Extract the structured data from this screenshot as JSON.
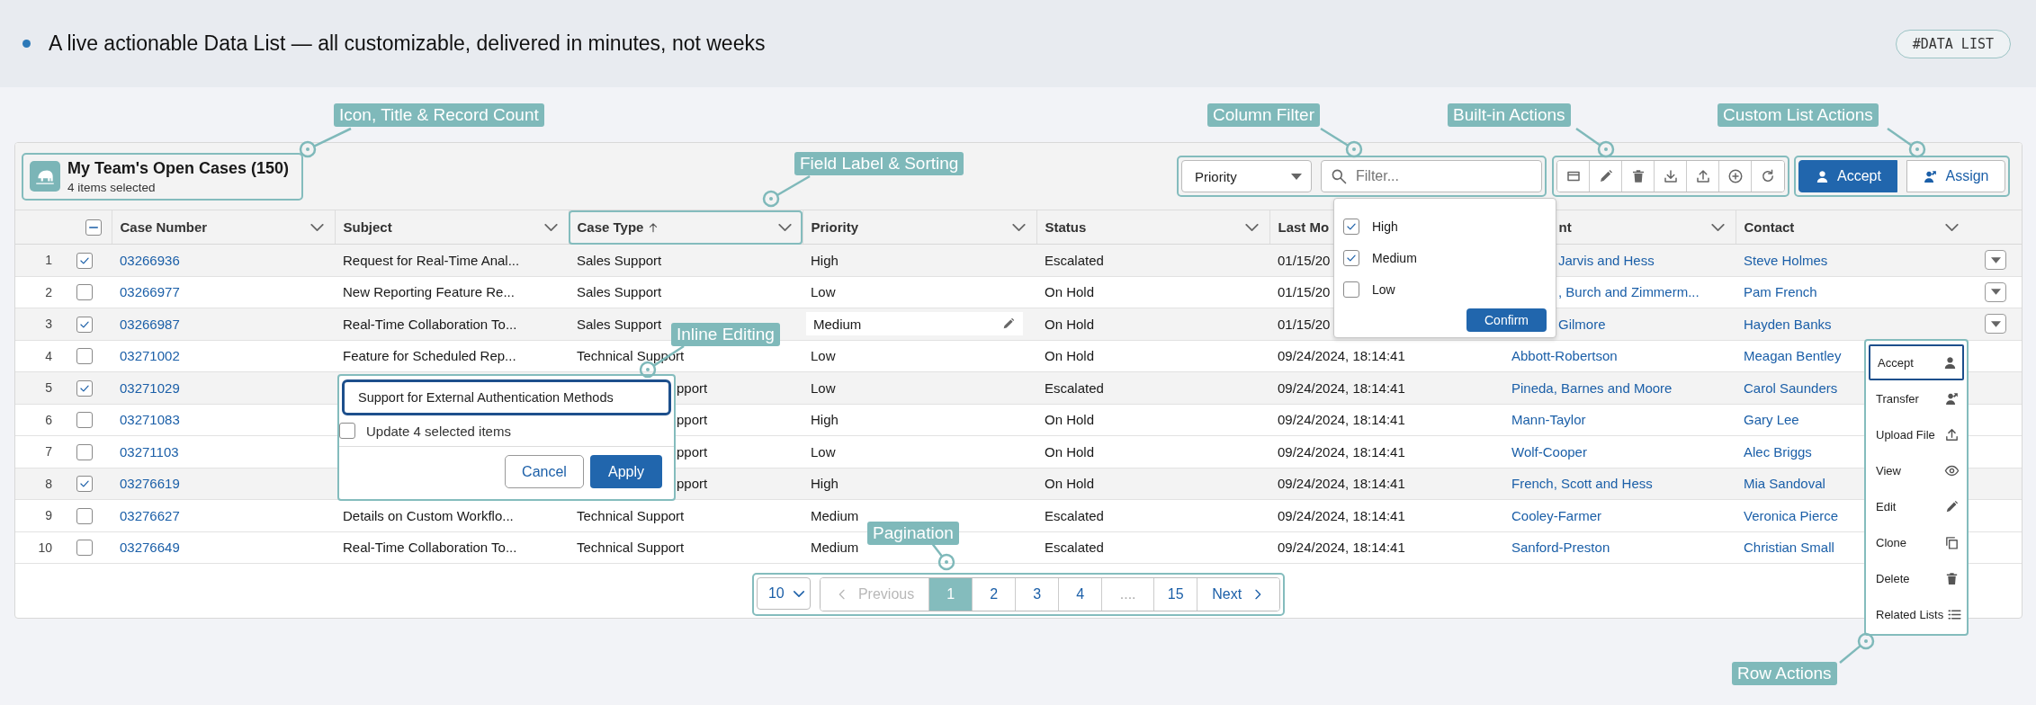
{
  "banner": {
    "text": "A live actionable Data List — all customizable, delivered in minutes, not weeks",
    "tag": "#DATA LIST"
  },
  "list": {
    "title": "My Team's Open Cases (150)",
    "subtitle": "4 items selected"
  },
  "filter": {
    "field": "Priority",
    "placeholder": "Filter...",
    "open": true,
    "confirm": "Confirm",
    "options": [
      {
        "label": "High",
        "checked": true
      },
      {
        "label": "Medium",
        "checked": true
      },
      {
        "label": "Low",
        "checked": false
      }
    ]
  },
  "built_in_actions": [
    {
      "kind": "card"
    },
    {
      "kind": "edit"
    },
    {
      "kind": "delete"
    },
    {
      "kind": "download"
    },
    {
      "kind": "upload"
    },
    {
      "kind": "add"
    },
    {
      "kind": "refresh"
    }
  ],
  "custom_actions": [
    {
      "label": "Accept",
      "kind": "accept",
      "primary": true
    },
    {
      "label": "Assign",
      "kind": "assign",
      "primary": false
    }
  ],
  "table": {
    "select_all": {
      "indeterminate": true
    },
    "columns": [
      {
        "label": "Case Number",
        "kind": "link",
        "sorted": false
      },
      {
        "label": "Subject",
        "kind": "text",
        "sorted": false
      },
      {
        "label": "Case Type",
        "kind": "text",
        "sorted": true
      },
      {
        "label": "Priority",
        "kind": "text",
        "sorted": false
      },
      {
        "label": "Status",
        "kind": "text",
        "sorted": false
      },
      {
        "label": "Last Mo",
        "kind": "text",
        "sorted": false
      },
      {
        "label": "nt",
        "kind": "link",
        "sorted": false
      },
      {
        "label": "Contact",
        "kind": "link",
        "sorted": false
      }
    ],
    "rows": [
      {
        "number": "1",
        "checked": true,
        "editing": false,
        "cells": [
          "03266936",
          "Request for Real-Time Anal...",
          "Sales Support",
          "High",
          "Escalated",
          "01/15/20",
          "Jarvis and Hess",
          "Steve Holmes"
        ]
      },
      {
        "number": "2",
        "checked": false,
        "editing": false,
        "cells": [
          "03266977",
          "New Reporting Feature Re...",
          "Sales Support",
          "Low",
          "On Hold",
          "01/15/20",
          ", Burch and Zimmerm...",
          "Pam French"
        ]
      },
      {
        "number": "3",
        "checked": true,
        "editing": true,
        "cells": [
          "03266987",
          "Real-Time Collaboration To...",
          "Sales Support",
          "Medium",
          "On Hold",
          "01/15/20",
          "Gilmore",
          "Hayden Banks"
        ]
      },
      {
        "number": "4",
        "checked": false,
        "editing": false,
        "cells": [
          "03271002",
          "Feature for Scheduled Rep...",
          "Technical Support",
          "Low",
          "On Hold",
          "09/24/2024, 18:14:41",
          "Abbott-Robertson",
          "Meagan Bentley"
        ]
      },
      {
        "number": "5",
        "checked": true,
        "editing": false,
        "cells": [
          "03271029",
          null,
          "pport",
          "Low",
          "Escalated",
          "09/24/2024, 18:14:41",
          "Pineda, Barnes and Moore",
          "Carol Saunders"
        ]
      },
      {
        "number": "6",
        "checked": false,
        "editing": false,
        "cells": [
          "03271083",
          null,
          "pport",
          "High",
          "On Hold",
          "09/24/2024, 18:14:41",
          "Mann-Taylor",
          "Gary Lee"
        ]
      },
      {
        "number": "7",
        "checked": false,
        "editing": false,
        "cells": [
          "03271103",
          null,
          "pport",
          "Low",
          "On Hold",
          "09/24/2024, 18:14:41",
          "Wolf-Cooper",
          "Alec Briggs"
        ]
      },
      {
        "number": "8",
        "checked": true,
        "editing": false,
        "cells": [
          "03276619",
          null,
          "pport",
          "High",
          "On Hold",
          "09/24/2024, 18:14:41",
          "French, Scott and Hess",
          "Mia Sandoval"
        ]
      },
      {
        "number": "9",
        "checked": false,
        "editing": false,
        "cells": [
          "03276627",
          "Details on Custom Workflo...",
          "Technical Support",
          "Medium",
          "Escalated",
          "09/24/2024, 18:14:41",
          "Cooley-Farmer",
          "Veronica Pierce"
        ]
      },
      {
        "number": "10",
        "checked": false,
        "editing": false,
        "cells": [
          "03276649",
          "Real-Time Collaboration To...",
          "Technical Support",
          "Medium",
          "Escalated",
          "09/24/2024, 18:14:41",
          "Sanford-Preston",
          "Christian Small"
        ]
      }
    ]
  },
  "inline_editor": {
    "value": "Support for External Authentication Methods",
    "update_all": {
      "label": "Update 4 selected items",
      "checked": false
    },
    "cancel": "Cancel",
    "apply": "Apply"
  },
  "row_menu": {
    "open": true,
    "items": [
      {
        "label": "Accept",
        "kind": "accept",
        "selected": true
      },
      {
        "label": "Transfer",
        "kind": "assign",
        "selected": false
      },
      {
        "label": "Upload File",
        "kind": "upload",
        "selected": false
      },
      {
        "label": "View",
        "kind": "view",
        "selected": false
      },
      {
        "label": "Edit",
        "kind": "edit",
        "selected": false
      },
      {
        "label": "Clone",
        "kind": "clone",
        "selected": false
      },
      {
        "label": "Delete",
        "kind": "delete",
        "selected": false
      },
      {
        "label": "Related Lists",
        "kind": "related",
        "selected": false
      }
    ]
  },
  "pagination": {
    "page_size": "10",
    "previous": "Previous",
    "previous_disabled": true,
    "next": "Next",
    "next_disabled": false,
    "pages": [
      {
        "label": "1",
        "kind": "page",
        "selected": true
      },
      {
        "label": "2",
        "kind": "page",
        "selected": false
      },
      {
        "label": "3",
        "kind": "page",
        "selected": false
      },
      {
        "label": "4",
        "kind": "page",
        "selected": false
      },
      {
        "label": "....",
        "kind": "gap",
        "selected": false
      },
      {
        "label": "15",
        "kind": "page",
        "selected": false
      }
    ]
  },
  "annotations": [
    "Icon, Title & Record Count",
    "Field Label & Sorting",
    "Column Filter",
    "Built-in Actions",
    "Custom List Actions",
    "Inline Editing",
    "Pagination",
    "Row Actions"
  ]
}
